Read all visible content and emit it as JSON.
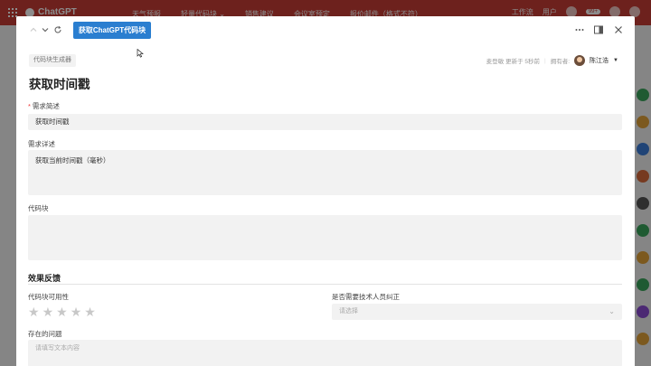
{
  "app": {
    "brand": "ChatGPT",
    "top_tabs": [
      "天气预报",
      "轻量代码块 ⌄",
      "销售建议",
      "会议室预定",
      "报价邮件（格式不符）"
    ],
    "right_items": {
      "workflow": "工作流",
      "user": "用户",
      "badge": "99+"
    }
  },
  "modal": {
    "primary_button": "获取ChatGPT代码块",
    "tag": "代码块生成器",
    "meta": {
      "updated": "麦登敏 更新于 5秒前",
      "owner_label": "拥有者:",
      "owner_name": "陈江浩"
    },
    "title": "获取时间戳",
    "fields": {
      "summary": {
        "label": "需求简述",
        "required": "*",
        "value": "获取时间戳"
      },
      "detail": {
        "label": "需求详述",
        "value": "获取当前时间戳（毫秒）"
      },
      "code": {
        "label": "代码块",
        "value": ""
      }
    },
    "feedback": {
      "section_title": "效果反馈",
      "usability_label": "代码块可用性",
      "stars": [
        "★",
        "★",
        "★",
        "★",
        "★"
      ],
      "rating": 0,
      "correction_label": "是否需要技术人员纠正",
      "correction_placeholder": "请选择",
      "issues_label": "存在的问题",
      "issues_placeholder": "请填写文本内容"
    }
  },
  "colors": {
    "primary": "#2a7ed0",
    "topbar": "#c73c35"
  }
}
